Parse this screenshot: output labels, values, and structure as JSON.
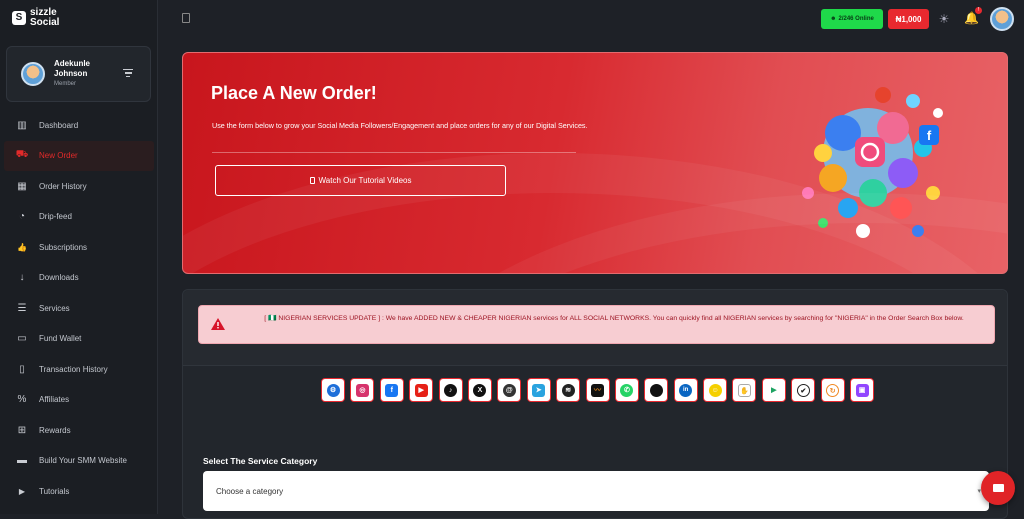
{
  "brand": {
    "name": "sizzle Social",
    "mark": "S"
  },
  "user": {
    "name": "Adekunle Johnson",
    "role": "Member"
  },
  "nav": [
    {
      "label": "Dashboard",
      "icon": "chart-icon",
      "glyph": "▥"
    },
    {
      "label": "New Order",
      "icon": "cart-icon",
      "glyph": "⛟",
      "active": true
    },
    {
      "label": "Order History",
      "icon": "calendar-icon",
      "glyph": "▦"
    },
    {
      "label": "Drip-feed",
      "icon": "clock-icon",
      "glyph": "◔"
    },
    {
      "label": "Subscriptions",
      "icon": "thumbs-up-icon",
      "glyph": "👍"
    },
    {
      "label": "Downloads",
      "icon": "arrow-down-icon",
      "glyph": "↓"
    },
    {
      "label": "Services",
      "icon": "list-icon",
      "glyph": "☰"
    },
    {
      "label": "Fund Wallet",
      "icon": "wallet-icon",
      "glyph": "▭"
    },
    {
      "label": "Transaction History",
      "icon": "file-icon",
      "glyph": "▯"
    },
    {
      "label": "Affiliates",
      "icon": "percent-icon",
      "glyph": "%"
    },
    {
      "label": "Rewards",
      "icon": "gift-icon",
      "glyph": "⊞"
    },
    {
      "label": "Build Your SMM Website",
      "icon": "laptop-icon",
      "glyph": "▬"
    },
    {
      "label": "Tutorials",
      "icon": "play-icon",
      "glyph": "▶"
    }
  ],
  "topbar": {
    "online": "2/246 Online",
    "balance": "₦1,000",
    "notification_count": "!"
  },
  "hero": {
    "title": "Place A New Order!",
    "text": "Use the form below to grow your Social Media Followers/Engagement and place orders for any of our Digital Services.",
    "button": "Watch Our Tutorial Videos"
  },
  "alert": {
    "text": "[ 🇳🇬 NIGERIAN SERVICES UPDATE ] : We have ADDED NEW & CHEAPER NIGERIAN services for ALL SOCIAL NETWORKS. You can quickly find all NIGERIAN services by searching for \"NIGERIA\" in the Order Search Box below."
  },
  "platforms": [
    {
      "name": "all-platforms",
      "color": "#1e6fd9",
      "glyph": "⚙"
    },
    {
      "name": "instagram",
      "color": "#d6336c",
      "glyph": "◎"
    },
    {
      "name": "facebook",
      "color": "#1877f2",
      "glyph": "f"
    },
    {
      "name": "youtube",
      "color": "#e62117",
      "glyph": "▶"
    },
    {
      "name": "tiktok",
      "color": "#111111",
      "glyph": "♪"
    },
    {
      "name": "x-twitter",
      "color": "#111111",
      "glyph": "X"
    },
    {
      "name": "threads",
      "color": "#333333",
      "glyph": "@"
    },
    {
      "name": "telegram",
      "color": "#2aa3df",
      "glyph": "➤"
    },
    {
      "name": "spotify",
      "color": "#222222",
      "glyph": "≋"
    },
    {
      "name": "audiomack",
      "color": "#f7931e",
      "glyph": "〰"
    },
    {
      "name": "whatsapp",
      "color": "#25d366",
      "glyph": "✆"
    },
    {
      "name": "apple",
      "color": "#111111",
      "glyph": ""
    },
    {
      "name": "linkedin",
      "color": "#0a66c2",
      "glyph": "in"
    },
    {
      "name": "snapchat",
      "color": "#f5d000",
      "glyph": "☺"
    },
    {
      "name": "clubhouse",
      "color": "#777777",
      "glyph": "✋"
    },
    {
      "name": "google-play",
      "color": "#1ea362",
      "glyph": "▶"
    },
    {
      "name": "verified",
      "color": "#222222",
      "glyph": "✔"
    },
    {
      "name": "boomplay",
      "color": "#f08a24",
      "glyph": "↻"
    },
    {
      "name": "twitch",
      "color": "#9146ff",
      "glyph": "▣"
    }
  ],
  "category": {
    "label": "Select The Service Category",
    "placeholder": "Choose a category"
  },
  "colors": {
    "accent": "#e8292f",
    "online": "#1fd94a",
    "sidebar": "#1b1e23",
    "panel": "#22262c"
  }
}
